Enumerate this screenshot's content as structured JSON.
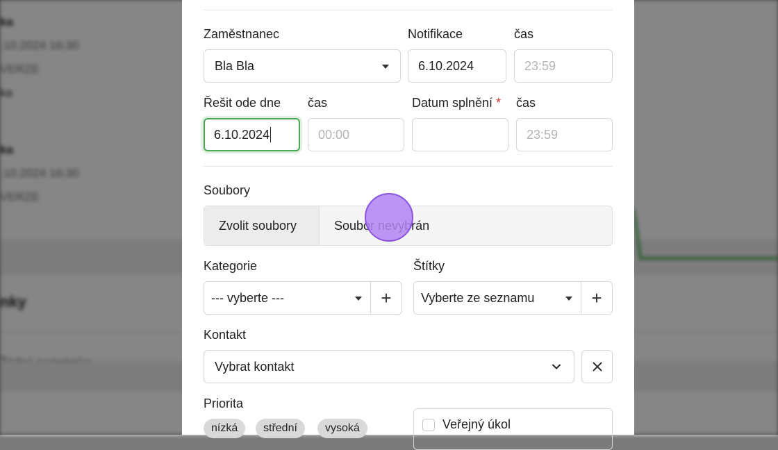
{
  "form": {
    "employee": {
      "label": "Zaměstnanec",
      "value": "Bla Bla"
    },
    "notification": {
      "label": "Notifikace",
      "value": "6.10.2024"
    },
    "notification_time": {
      "label": "čas",
      "placeholder": "23:59"
    },
    "solve_from": {
      "label": "Řešit ode dne",
      "value": "6.10.2024"
    },
    "solve_from_time": {
      "label": "čas",
      "placeholder": "00:00"
    },
    "due_date": {
      "label": "Datum splnění",
      "required_mark": "*",
      "value": ""
    },
    "due_time": {
      "label": "čas",
      "placeholder": "23:59"
    },
    "files": {
      "label": "Soubory",
      "button": "Zvolit soubory",
      "status": "Soubor nevybrán"
    },
    "category": {
      "label": "Kategorie",
      "value": "--- vyberte ---",
      "add": "+"
    },
    "tags": {
      "label": "Štítky",
      "value": "Vyberte ze seznamu",
      "add": "+"
    },
    "contact": {
      "label": "Kontakt",
      "value": "Vybrat kontakt"
    },
    "priority": {
      "label": "Priorita",
      "options": [
        "nízká",
        "střední",
        "vysoká"
      ]
    },
    "public": {
      "label": "Veřejný úkol"
    }
  },
  "icons": {
    "dropdown": "caret-down-icon",
    "chevron": "chevron-down-icon",
    "clear": "close-icon"
  },
  "colors": {
    "focus_border": "#4ca856",
    "required": "#d9342b",
    "cursor": "#b282f2"
  }
}
